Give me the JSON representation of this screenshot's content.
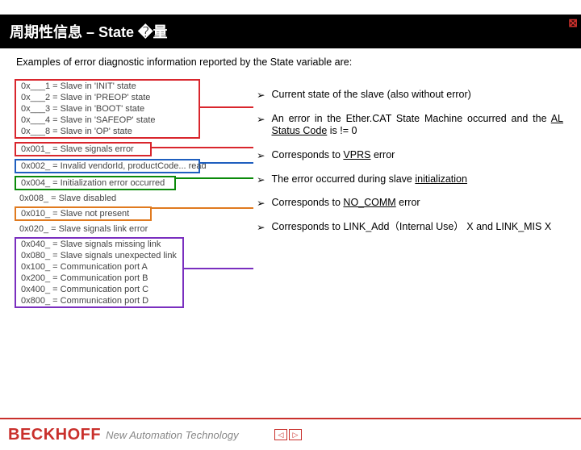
{
  "close_glyph": "⊠",
  "title": "周期性信息 – State �量",
  "intro": "Examples of error diagnostic information reported by the State variable are:",
  "left": {
    "states": [
      "0x___1 = Slave in 'INIT' state",
      "0x___2 = Slave in 'PREOP' state",
      "0x___3 = Slave in 'BOOT' state",
      "0x___4 = Slave in 'SAFEOP' state",
      "0x___8 = Slave in 'OP' state"
    ],
    "err_signals": "0x001_ = Slave signals error",
    "err_vendor": "0x002_ = Invalid vendorId, productCode... read",
    "err_init": "0x004_ = Initialization error occurred",
    "slave_disabled": "0x008_ = Slave disabled",
    "not_present": "0x010_ = Slave not present",
    "link_error": "0x020_ = Slave signals link error",
    "link_group": [
      "0x040_ = Slave signals missing link",
      "0x080_ = Slave signals unexpected link",
      "0x100_ = Communication port A",
      "0x200_ = Communication port B",
      "0x400_ = Communication port C",
      "0x800_ = Communication port D"
    ]
  },
  "bullets": {
    "b1": "Current state of the slave (also without error)",
    "b2a": "An error in the Ether.CAT State Machine occurred and the ",
    "b2u": "AL Status Code",
    "b2b": " is != 0",
    "b3a": "Corresponds to ",
    "b3u": "VPRS",
    "b3b": " error",
    "b4a": "The error occurred during slave ",
    "b4u": "initialization",
    "b5a": "Corresponds to ",
    "b5u": "NO_COMM",
    "b5b": " error",
    "b6": "Corresponds to LINK_Add（Internal Use） X and LINK_MIS X"
  },
  "arrow": "➢",
  "footer": {
    "brand": "BECKHOFF",
    "tag": "New Automation Technology",
    "prev": "◁",
    "next": "▷"
  }
}
